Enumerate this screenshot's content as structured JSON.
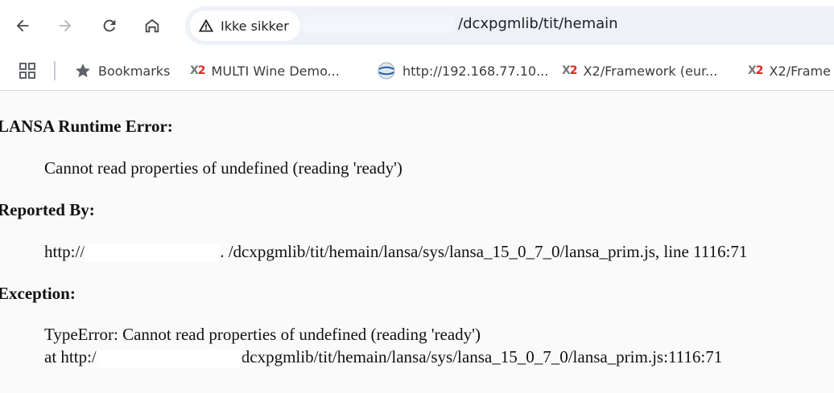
{
  "toolbar": {
    "security_label": "Ikke sikker",
    "url_path": "/dcxpgmlib/tit/hemain",
    "buttons": [
      "back",
      "forward",
      "reload",
      "home"
    ]
  },
  "bookmarks_bar": {
    "apps_icon": "apps-grid-icon",
    "items": [
      {
        "label": "Bookmarks",
        "icon": "star-icon"
      },
      {
        "label": "MULTI Wine Demo...",
        "icon": "x2-logo-icon"
      },
      {
        "label": "http://192.168.77.10...",
        "icon": "globe-icon"
      },
      {
        "label": "X2/Framework (eur...",
        "icon": "x2-logo-icon"
      },
      {
        "label": "X2/Frame",
        "icon": "x2-logo-icon"
      }
    ]
  },
  "page": {
    "error_heading": "LANSA Runtime Error:",
    "error_message": "Cannot read properties of undefined (reading 'ready')",
    "reported_heading": "Reported By:",
    "reported_prefix": "http://",
    "reported_path": ".  /dcxpgmlib/tit/hemain/lansa/sys/lansa_15_0_7_0/lansa_prim.js, line 1116:71",
    "exception_heading": "Exception:",
    "exception_line1": "TypeError: Cannot read properties of undefined (reading 'ready')",
    "exception_line2_prefix": "at http:/",
    "exception_line2_path": "dcxpgmlib/tit/hemain/lansa/sys/lansa_15_0_7_0/lansa_prim.js:1116:71"
  },
  "colors": {
    "omnibox_bg": "#eef1f8",
    "content_bg": "#fafafa",
    "x2_red": "#e2231a"
  }
}
